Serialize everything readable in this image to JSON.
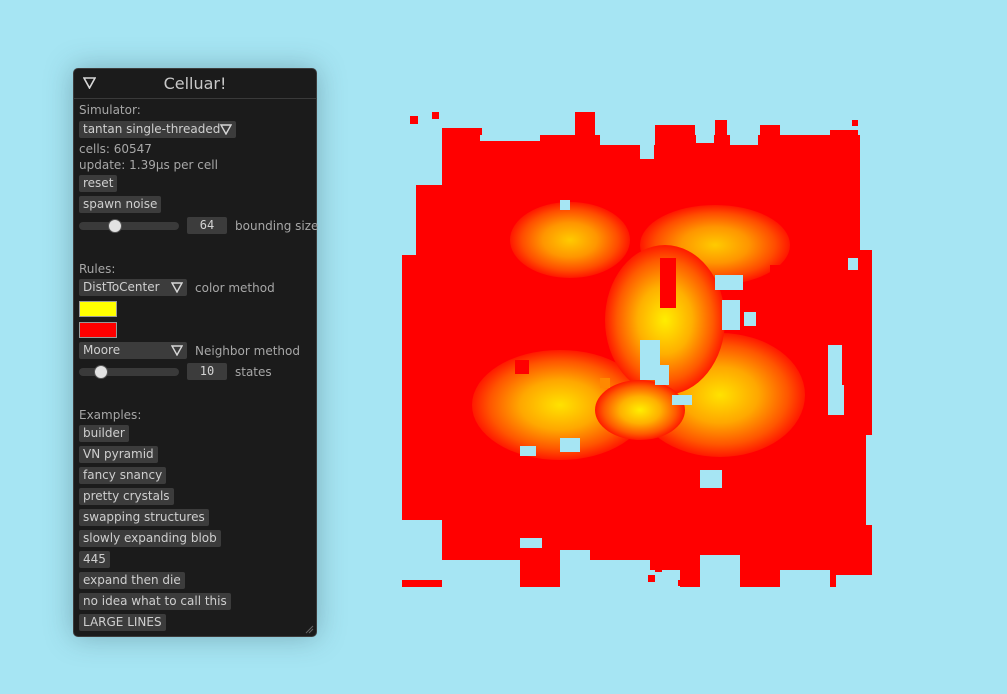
{
  "viewport": {
    "background": "#a6e5f3",
    "color_near": "#ffff00",
    "color_far": "#ff0000"
  },
  "panel": {
    "title": "Celluar!",
    "simulator_label": "Simulator:",
    "simulator_value": "tantan single-threaded",
    "cells": "cells: 60547",
    "update": "update: 1.39μs per cell",
    "reset": "reset",
    "spawn_noise": "spawn noise",
    "bounding_value": "64",
    "bounding_label": "bounding size",
    "rules_label": "Rules:",
    "color_method_value": "DistToCenter",
    "color_method_label": "color method",
    "color_a": "#ffff00",
    "color_b": "#ff0000",
    "neighbor_value": "Moore",
    "neighbor_label": "Neighbor method",
    "states_value": "10",
    "states_label": "states",
    "examples_label": "Examples:",
    "examples": [
      "builder",
      "VN pyramid",
      "fancy snancy",
      "pretty crystals",
      "swapping structures",
      "slowly expanding blob",
      "445",
      "expand then die",
      "no idea what to call this",
      "LARGE LINES"
    ]
  }
}
